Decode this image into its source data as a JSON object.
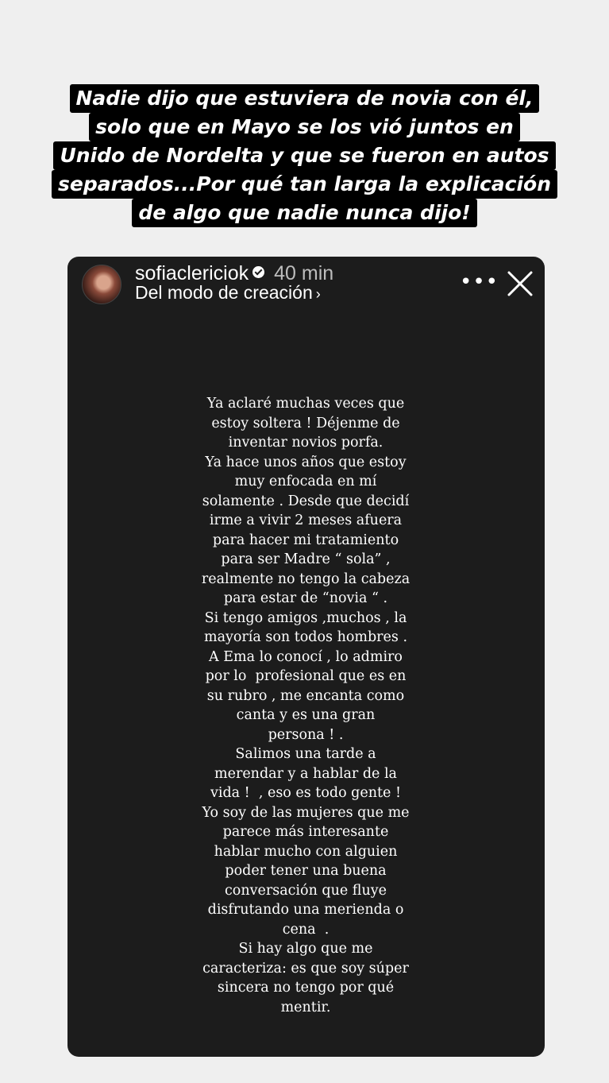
{
  "caption": {
    "lines": [
      "Nadie dijo que estuviera de novia con él,",
      "solo que en Mayo se los vió juntos en",
      "Unido de Nordelta y que se fueron en autos",
      "separados...Por qué tan larga la explicación",
      "de algo que nadie nunca dijo!"
    ]
  },
  "story": {
    "username": "sofiaclericiok",
    "time": "40 min",
    "subtitle": "Del modo de creación",
    "icons": {
      "verified": "verified-badge-icon",
      "more": "more-options-icon",
      "close": "close-icon",
      "chevron": "chevron-right-icon"
    },
    "text_lines": [
      "Ya aclaré muchas veces que",
      "estoy soltera ! Déjenme de",
      "inventar novios porfa.",
      "Ya hace unos años que estoy",
      "muy enfocada en mí",
      "solamente . Desde que decidí",
      "irme a vivir 2 meses afuera",
      "para hacer mi tratamiento",
      "para ser Madre “ sola” ,",
      "realmente no tengo la cabeza",
      "para estar de “novia “ .",
      "Si tengo amigos ,muchos , la",
      "mayoría son todos hombres .",
      "A Ema lo conocí , lo admiro",
      "por lo  profesional que es en",
      "su rubro , me encanta como",
      "canta y es una gran",
      "persona ! .",
      "Salimos una tarde a",
      "merendar y a hablar de la",
      "vida !  , eso es todo gente !",
      "Yo soy de las mujeres que me",
      "parece más interesante",
      "hablar mucho con alguien",
      "poder tener una buena",
      "conversación que fluye",
      "disfrutando una merienda o",
      "cena  .",
      "Si hay algo que me",
      "caracteriza: es que soy súper",
      "sincera no tengo por qué",
      "mentir."
    ]
  }
}
